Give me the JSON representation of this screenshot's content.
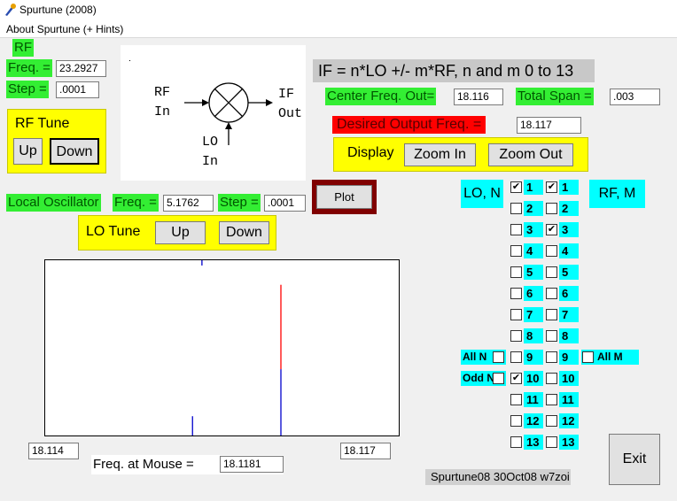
{
  "window": {
    "title": "Spurtune (2008)",
    "menu": "About Spurtune (+ Hints)"
  },
  "rf": {
    "heading": "RF",
    "freq_label": "Freq. =",
    "freq_value": "23.2927",
    "step_label": "Step =",
    "step_value": ".0001",
    "tune_title": "RF Tune",
    "up_label": "Up",
    "down_label": "Down"
  },
  "diagram": {
    "rf_in_1": "RF",
    "rf_in_2": "In",
    "if_out_1": "IF",
    "if_out_2": "Out",
    "lo_in_1": "LO",
    "lo_in_2": "In"
  },
  "formula": "IF = n*LO +/-  m*RF, n and m 0 to 13",
  "center": {
    "label": "Center Freq. Out=",
    "value": "18.116"
  },
  "span": {
    "label": "Total Span =",
    "value": ".003"
  },
  "desired": {
    "label": "Desired Output Freq. =",
    "value": "18.117"
  },
  "display": {
    "label": "Display",
    "zoom_in": "Zoom In",
    "zoom_out": "Zoom Out"
  },
  "lo": {
    "label": "Local Oscillator",
    "freq_label": "Freq. =",
    "freq_value": "5.1762",
    "step_label": "Step =",
    "step_value": ".0001",
    "tune_title": "LO Tune",
    "up_label": "Up",
    "down_label": "Down"
  },
  "plot_button": "Plot",
  "lo_n_label": "LO, N",
  "rf_m_label": "RF, M",
  "n_numbers": [
    "1",
    "2",
    "3",
    "4",
    "5",
    "6",
    "7",
    "8",
    "9",
    "10",
    "11",
    "12",
    "13"
  ],
  "n_checked": [
    true,
    false,
    false,
    false,
    false,
    false,
    false,
    false,
    false,
    true,
    false,
    false,
    false
  ],
  "m_numbers": [
    "1",
    "2",
    "3",
    "4",
    "5",
    "6",
    "7",
    "8",
    "9",
    "10",
    "11",
    "12",
    "13"
  ],
  "m_checked": [
    true,
    false,
    true,
    false,
    false,
    false,
    false,
    false,
    false,
    false,
    false,
    false,
    false
  ],
  "all_n": "All N",
  "odd_n": "Odd N",
  "all_m": "All M",
  "axis": {
    "left": "18.114",
    "right": "18.117"
  },
  "mouse": {
    "label": "Freq. at Mouse =",
    "value": "18.1181"
  },
  "version": "Spurtune08 30Oct08 w7zoi",
  "exit": "Exit",
  "spurs": [
    {
      "freq": 18.11525,
      "height": 0.11,
      "color": "#0000cc"
    },
    {
      "freq": 18.116,
      "height": 0.86,
      "color": "#0000cc",
      "top_color": "#ff0000",
      "split": 0.44
    },
    {
      "freq": 18.11533,
      "height": 0.03,
      "color": "#0000cc",
      "top": true
    }
  ],
  "colors": {
    "green": "#33ee33",
    "yellow": "#ffff00",
    "cyan": "#00ffff",
    "red": "#ff0000",
    "plot_border": "#800000"
  }
}
